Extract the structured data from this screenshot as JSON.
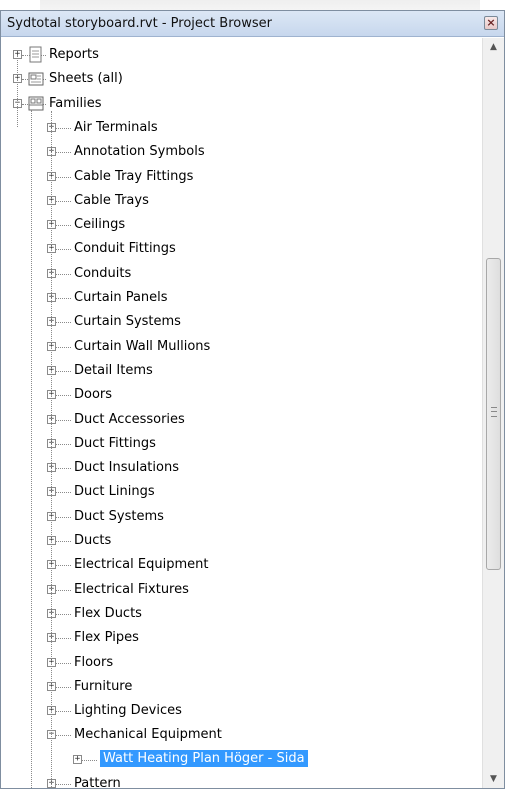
{
  "window": {
    "title": "Sydtotal storyboard.rvt - Project Browser"
  },
  "tree": {
    "top_items": [
      {
        "label": "Reports",
        "expanded": false,
        "icon": "report-icon"
      },
      {
        "label": "Sheets (all)",
        "expanded": false,
        "icon": "sheets-icon"
      },
      {
        "label": "Families",
        "expanded": true,
        "icon": "families-icon"
      }
    ],
    "families": [
      "Air Terminals",
      "Annotation Symbols",
      "Cable Tray Fittings",
      "Cable Trays",
      "Ceilings",
      "Conduit Fittings",
      "Conduits",
      "Curtain Panels",
      "Curtain Systems",
      "Curtain Wall Mullions",
      "Detail Items",
      "Doors",
      "Duct Accessories",
      "Duct Fittings",
      "Duct Insulations",
      "Duct Linings",
      "Duct Systems",
      "Ducts",
      "Electrical Equipment",
      "Electrical Fixtures",
      "Flex Ducts",
      "Flex Pipes",
      "Floors",
      "Furniture",
      "Lighting Devices",
      "Mechanical Equipment"
    ],
    "expanded_family": "Mechanical Equipment",
    "selected_child": "Watt Heating Plan Höger - Sida",
    "after_items": [
      "Pattern"
    ]
  },
  "colors": {
    "selection": "#3399ff",
    "titlebar": "#c7d7ed"
  }
}
